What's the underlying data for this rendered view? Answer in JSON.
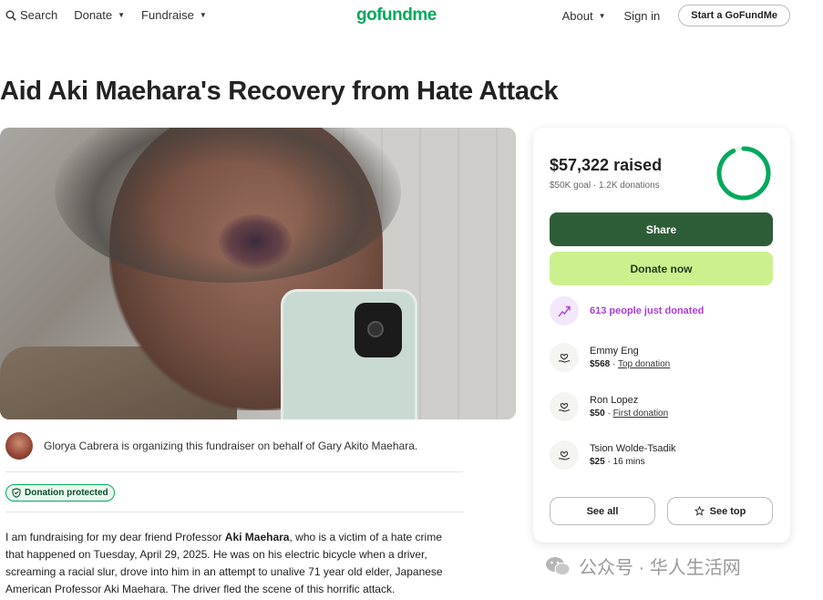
{
  "nav": {
    "search": "Search",
    "donate": "Donate",
    "fundraise": "Fundraise",
    "logo": "gofundme",
    "about": "About",
    "signin": "Sign in",
    "start": "Start a GoFundMe"
  },
  "title": "Aid Aki Maehara's Recovery from Hate Attack",
  "organizer": "Glorya Cabrera is organizing this fundraiser on behalf of Gary Akito Maehara.",
  "badge": "Donation protected",
  "story": {
    "p1": "I am fundraising for my dear friend Professor ",
    "name": "Aki Maehara",
    "p2": ", who is a victim of a hate crime that happened on Tuesday, April 29, 2025. He was on his electric bicycle when a driver, screaming a racial slur, drove into him in an attempt to unalive 71 year old elder, Japanese American Professor Aki Maehara. The driver fled the scene of this horrific attack."
  },
  "card": {
    "raised": "$57,322 raised",
    "goal": "$50K goal",
    "donations": "1.2K donations",
    "progress": 1.0,
    "share": "Share",
    "donate_now": "Donate now",
    "recent": "613 people just donated",
    "donors": [
      {
        "name": "Emmy Eng",
        "amount": "$568",
        "note": "Top donation",
        "link": true
      },
      {
        "name": "Ron Lopez",
        "amount": "$50",
        "note": "First donation",
        "link": true
      },
      {
        "name": "Tsion Wolde-Tsadik",
        "amount": "$25",
        "note": "16 mins",
        "link": false
      }
    ],
    "see_all": "See all",
    "see_top": "See top"
  },
  "colors": {
    "brand": "#02a95c",
    "share_bg": "#2d5d36",
    "donate_bg": "#cdf08f",
    "trend": "#a83fd6"
  },
  "watermark": "公众号 · 华人生活网"
}
